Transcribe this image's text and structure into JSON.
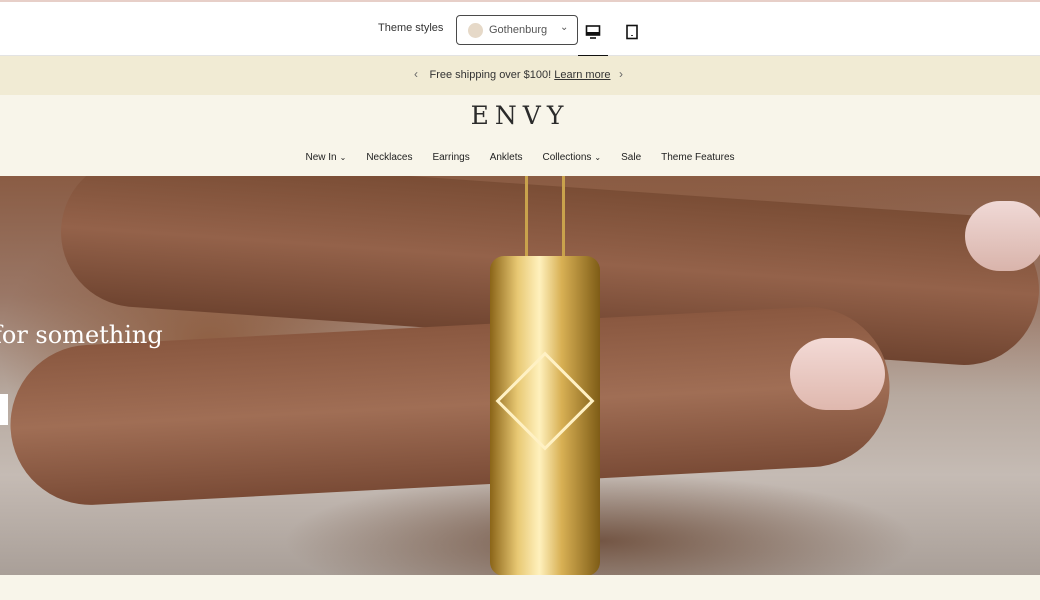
{
  "preview": {
    "theme_label": "Theme styles",
    "selected_style": "Gothenburg",
    "swatch_color": "#e6d9c8"
  },
  "announcement": {
    "text": "Free shipping over $100!",
    "link": "Learn more"
  },
  "brand": {
    "logo": "ENVY"
  },
  "nav": {
    "items": [
      {
        "label": "New In",
        "has_dropdown": true
      },
      {
        "label": "Necklaces",
        "has_dropdown": false
      },
      {
        "label": "Earrings",
        "has_dropdown": false
      },
      {
        "label": "Anklets",
        "has_dropdown": false
      },
      {
        "label": "Collections",
        "has_dropdown": true
      },
      {
        "label": "Sale",
        "has_dropdown": false
      },
      {
        "label": "Theme Features",
        "has_dropdown": false
      }
    ]
  },
  "hero": {
    "heading": "g for something"
  }
}
